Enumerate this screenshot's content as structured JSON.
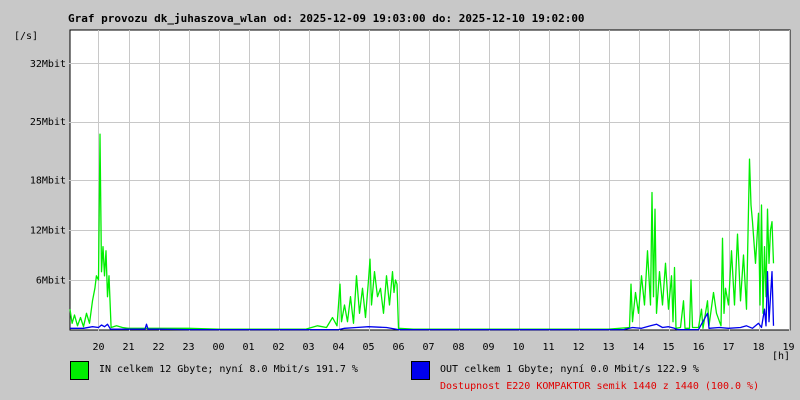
{
  "title": "Graf provozu dk_juhaszova_wlan od: 2025-12-09 19:03:00 do: 2025-12-10 19:02:00",
  "y_unit": "[/s]",
  "x_unit": "[h]",
  "legend": {
    "in": {
      "text": "IN celkem 12 Gbyte; nyní   8.0 Mbit/s 191.7 %",
      "color": "#00ee00"
    },
    "out": {
      "text": "OUT celkem 1 Gbyte; nyní   0.0 Mbit/s 122.9 %",
      "color": "#0000ee"
    }
  },
  "availability": "Dostupnost E220 KOMPAKTOR semik 1440 z 1440 (100.0 %)",
  "chart_data": {
    "type": "line",
    "title": "Graf provozu dk_juhaszova_wlan od: 2025-12-09 19:03:00 do: 2025-12-10 19:02:00",
    "ylim": [
      0,
      36
    ],
    "y_ticks": [
      {
        "value": 6,
        "label": "6Mbit"
      },
      {
        "value": 12,
        "label": "12Mbit"
      },
      {
        "value": 18,
        "label": "18Mbit"
      },
      {
        "value": 25,
        "label": "25Mbit"
      },
      {
        "value": 32,
        "label": "32Mbit"
      }
    ],
    "x_range": [
      19.05,
      43.05
    ],
    "x_ticks": [
      {
        "value": 20,
        "label": "20"
      },
      {
        "value": 21,
        "label": "21"
      },
      {
        "value": 22,
        "label": "22"
      },
      {
        "value": 23,
        "label": "23"
      },
      {
        "value": 24,
        "label": "00"
      },
      {
        "value": 25,
        "label": "01"
      },
      {
        "value": 26,
        "label": "02"
      },
      {
        "value": 27,
        "label": "03"
      },
      {
        "value": 28,
        "label": "04"
      },
      {
        "value": 29,
        "label": "05"
      },
      {
        "value": 30,
        "label": "06"
      },
      {
        "value": 31,
        "label": "07"
      },
      {
        "value": 32,
        "label": "08"
      },
      {
        "value": 33,
        "label": "09"
      },
      {
        "value": 34,
        "label": "10"
      },
      {
        "value": 35,
        "label": "11"
      },
      {
        "value": 36,
        "label": "12"
      },
      {
        "value": 37,
        "label": "13"
      },
      {
        "value": 38,
        "label": "14"
      },
      {
        "value": 39,
        "label": "15"
      },
      {
        "value": 40,
        "label": "16"
      },
      {
        "value": 41,
        "label": "17"
      },
      {
        "value": 42,
        "label": "18"
      },
      {
        "value": 43,
        "label": "19"
      }
    ],
    "grid": true,
    "series": [
      {
        "name": "IN",
        "color": "#00ee00",
        "points": [
          [
            19.05,
            2.5
          ],
          [
            19.12,
            0.8
          ],
          [
            19.2,
            1.8
          ],
          [
            19.3,
            0.5
          ],
          [
            19.4,
            1.5
          ],
          [
            19.5,
            0.4
          ],
          [
            19.6,
            2.0
          ],
          [
            19.7,
            0.8
          ],
          [
            19.8,
            3.5
          ],
          [
            19.88,
            5.0
          ],
          [
            19.93,
            6.5
          ],
          [
            20.0,
            6.0
          ],
          [
            20.05,
            23.5
          ],
          [
            20.1,
            7.0
          ],
          [
            20.15,
            10.0
          ],
          [
            20.2,
            6.5
          ],
          [
            20.25,
            9.5
          ],
          [
            20.3,
            4.0
          ],
          [
            20.35,
            6.5
          ],
          [
            20.42,
            0.3
          ],
          [
            20.6,
            0.5
          ],
          [
            20.8,
            0.3
          ],
          [
            21.0,
            0.2
          ],
          [
            21.5,
            0.2
          ],
          [
            22.0,
            0.2
          ],
          [
            22.5,
            0.2
          ],
          [
            23.0,
            0.2
          ],
          [
            24.0,
            0.1
          ],
          [
            25.0,
            0.1
          ],
          [
            26.0,
            0.1
          ],
          [
            26.9,
            0.1
          ],
          [
            27.3,
            0.5
          ],
          [
            27.6,
            0.3
          ],
          [
            27.8,
            1.5
          ],
          [
            27.95,
            0.5
          ],
          [
            28.05,
            5.5
          ],
          [
            28.1,
            1.0
          ],
          [
            28.2,
            3.0
          ],
          [
            28.3,
            1.0
          ],
          [
            28.4,
            4.0
          ],
          [
            28.5,
            0.8
          ],
          [
            28.6,
            6.5
          ],
          [
            28.7,
            2.0
          ],
          [
            28.8,
            5.0
          ],
          [
            28.9,
            1.5
          ],
          [
            29.0,
            6.0
          ],
          [
            29.05,
            8.5
          ],
          [
            29.1,
            3.0
          ],
          [
            29.2,
            7.0
          ],
          [
            29.3,
            4.0
          ],
          [
            29.4,
            5.0
          ],
          [
            29.5,
            2.0
          ],
          [
            29.6,
            6.5
          ],
          [
            29.7,
            3.0
          ],
          [
            29.8,
            7.0
          ],
          [
            29.85,
            4.5
          ],
          [
            29.9,
            6.0
          ],
          [
            29.95,
            5.5
          ],
          [
            30.0,
            0.2
          ],
          [
            30.5,
            0.1
          ],
          [
            31.0,
            0.1
          ],
          [
            32.0,
            0.1
          ],
          [
            33.0,
            0.1
          ],
          [
            34.0,
            0.1
          ],
          [
            35.0,
            0.1
          ],
          [
            36.0,
            0.1
          ],
          [
            37.0,
            0.1
          ],
          [
            37.7,
            0.3
          ],
          [
            37.75,
            5.5
          ],
          [
            37.8,
            1.0
          ],
          [
            37.9,
            4.5
          ],
          [
            38.0,
            2.0
          ],
          [
            38.1,
            6.5
          ],
          [
            38.2,
            3.0
          ],
          [
            38.3,
            9.5
          ],
          [
            38.4,
            3.0
          ],
          [
            38.45,
            16.5
          ],
          [
            38.5,
            4.0
          ],
          [
            38.55,
            14.5
          ],
          [
            38.6,
            2.0
          ],
          [
            38.7,
            7.0
          ],
          [
            38.8,
            3.0
          ],
          [
            38.9,
            8.0
          ],
          [
            39.0,
            2.5
          ],
          [
            39.1,
            6.5
          ],
          [
            39.15,
            1.0
          ],
          [
            39.2,
            7.5
          ],
          [
            39.25,
            0.2
          ],
          [
            39.4,
            0.3
          ],
          [
            39.5,
            3.5
          ],
          [
            39.55,
            0.2
          ],
          [
            39.7,
            0.2
          ],
          [
            39.75,
            6.0
          ],
          [
            39.8,
            0.3
          ],
          [
            40.0,
            0.3
          ],
          [
            40.1,
            2.5
          ],
          [
            40.15,
            0.2
          ],
          [
            40.3,
            3.5
          ],
          [
            40.35,
            0.5
          ],
          [
            40.5,
            4.5
          ],
          [
            40.6,
            2.0
          ],
          [
            40.75,
            0.5
          ],
          [
            40.8,
            11.0
          ],
          [
            40.85,
            2.0
          ],
          [
            40.9,
            5.0
          ],
          [
            41.0,
            3.0
          ],
          [
            41.1,
            9.5
          ],
          [
            41.2,
            3.0
          ],
          [
            41.3,
            11.5
          ],
          [
            41.4,
            3.5
          ],
          [
            41.5,
            9.0
          ],
          [
            41.6,
            2.5
          ],
          [
            41.7,
            20.5
          ],
          [
            41.75,
            15.0
          ],
          [
            41.8,
            13.0
          ],
          [
            41.9,
            8.0
          ],
          [
            42.0,
            14.0
          ],
          [
            42.05,
            3.0
          ],
          [
            42.1,
            15.0
          ],
          [
            42.15,
            2.0
          ],
          [
            42.2,
            10.0
          ],
          [
            42.25,
            4.0
          ],
          [
            42.3,
            14.5
          ],
          [
            42.35,
            8.0
          ],
          [
            42.4,
            12.0
          ],
          [
            42.45,
            13.0
          ],
          [
            42.5,
            8.0
          ]
        ]
      },
      {
        "name": "OUT",
        "color": "#0000ee",
        "points": [
          [
            19.05,
            0.2
          ],
          [
            19.5,
            0.2
          ],
          [
            19.8,
            0.4
          ],
          [
            20.0,
            0.3
          ],
          [
            20.1,
            0.6
          ],
          [
            20.2,
            0.4
          ],
          [
            20.3,
            0.7
          ],
          [
            20.4,
            0.1
          ],
          [
            21.0,
            0.1
          ],
          [
            21.55,
            0.1
          ],
          [
            21.6,
            0.7
          ],
          [
            21.65,
            0.1
          ],
          [
            22.0,
            0.1
          ],
          [
            23.0,
            0.05
          ],
          [
            26.0,
            0.05
          ],
          [
            28.0,
            0.05
          ],
          [
            28.2,
            0.2
          ],
          [
            28.6,
            0.3
          ],
          [
            29.0,
            0.4
          ],
          [
            29.6,
            0.3
          ],
          [
            30.0,
            0.05
          ],
          [
            35.0,
            0.05
          ],
          [
            37.5,
            0.05
          ],
          [
            37.8,
            0.3
          ],
          [
            38.1,
            0.2
          ],
          [
            38.4,
            0.5
          ],
          [
            38.6,
            0.7
          ],
          [
            38.8,
            0.3
          ],
          [
            39.0,
            0.4
          ],
          [
            39.2,
            0.2
          ],
          [
            39.3,
            0.05
          ],
          [
            40.0,
            0.05
          ],
          [
            40.3,
            2.0
          ],
          [
            40.35,
            0.2
          ],
          [
            40.7,
            0.3
          ],
          [
            41.0,
            0.2
          ],
          [
            41.4,
            0.3
          ],
          [
            41.6,
            0.5
          ],
          [
            41.8,
            0.2
          ],
          [
            42.0,
            0.8
          ],
          [
            42.1,
            0.3
          ],
          [
            42.2,
            2.5
          ],
          [
            42.25,
            0.5
          ],
          [
            42.3,
            7.0
          ],
          [
            42.35,
            1.0
          ],
          [
            42.4,
            4.0
          ],
          [
            42.45,
            7.0
          ],
          [
            42.5,
            0.5
          ]
        ]
      }
    ]
  }
}
